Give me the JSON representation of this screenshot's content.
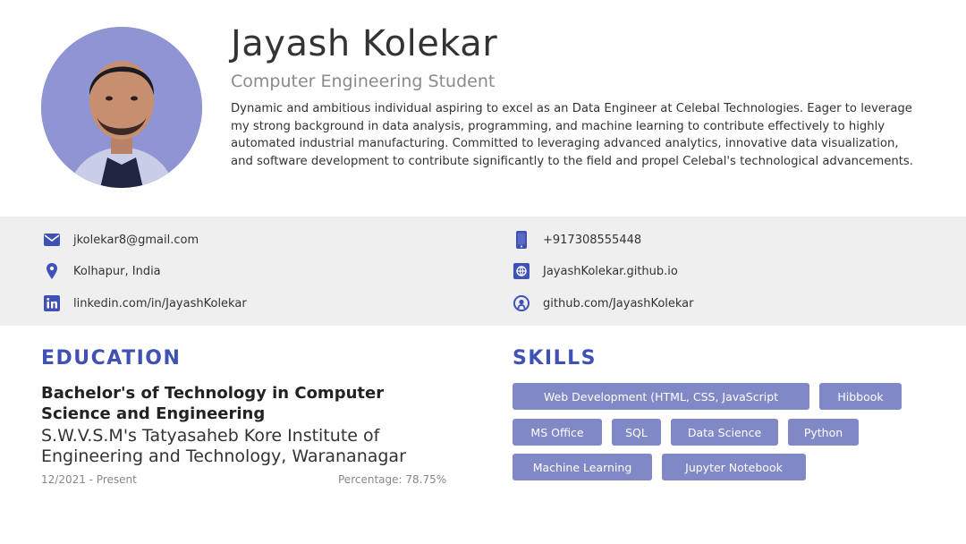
{
  "profile": {
    "name": "Jayash Kolekar",
    "title": "Computer Engineering Student",
    "summary": "Dynamic and ambitious individual aspiring to excel as an Data Engineer at Celebal Technologies. Eager to leverage my strong background in data analysis, programming, and machine learning to contribute effectively to highly automated industrial manufacturing. Committed to leveraging advanced analytics, innovative data visualization, and software development to contribute significantly to the field and propel Celebal's technological advancements."
  },
  "contacts": {
    "email": {
      "icon": "email-icon",
      "text": "jkolekar8@gmail.com"
    },
    "phone": {
      "icon": "phone-icon",
      "text": "+917308555448"
    },
    "location": {
      "icon": "location-pin-icon",
      "text": "Kolhapur, India"
    },
    "website": {
      "icon": "website-icon",
      "text": "JayashKolekar.github.io"
    },
    "linkedin": {
      "icon": "linkedin-icon",
      "text": "linkedin.com/in/JayashKolekar"
    },
    "github": {
      "icon": "github-icon",
      "text": "github.com/JayashKolekar"
    }
  },
  "education": {
    "heading": "EDUCATION",
    "degree": "Bachelor's of Technology in Computer Science and Engineering",
    "institute": "S.W.V.S.M's Tatyasaheb Kore Institute of Engineering and Technology, Warananagar",
    "dates": "12/2021 - Present",
    "score": "Percentage: 78.75%"
  },
  "skills": {
    "heading": "SKILLS",
    "items": [
      "Web Development (HTML, CSS, JavaScript",
      "Hibbook",
      "MS Office",
      "SQL",
      "Data Science",
      "Python",
      "Machine Learning",
      "Jupyter Notebook"
    ]
  },
  "colors": {
    "accent": "#3f51b5",
    "skill_tag": "#8088c6",
    "contact_band": "#efefef",
    "avatar_bg": "#8f95d3"
  }
}
